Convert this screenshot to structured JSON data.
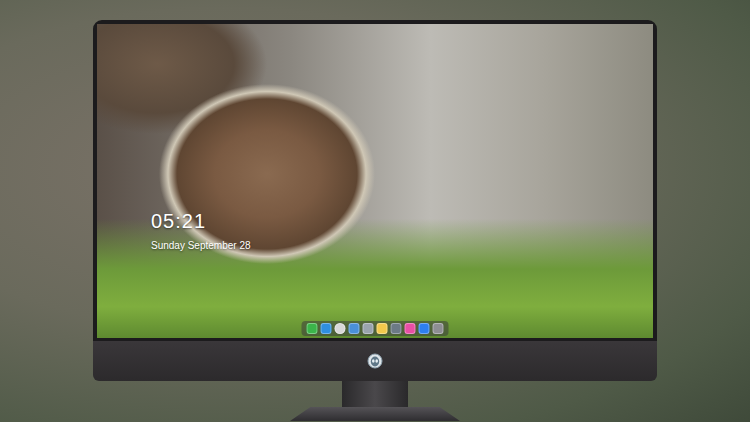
{
  "screen": {
    "time": "05:21",
    "date": "Sunday September 28"
  },
  "dock": {
    "items": [
      {
        "color": "#3bb54a"
      },
      {
        "color": "#2f8fe0"
      },
      {
        "color": "#d8d8d8"
      },
      {
        "color": "#4a90d9"
      },
      {
        "color": "#9aa4ad"
      },
      {
        "color": "#f2c94c"
      },
      {
        "color": "#6c7a86"
      },
      {
        "color": "#e84fa5"
      },
      {
        "color": "#2d7ff0"
      },
      {
        "color": "#8e8e93"
      }
    ]
  }
}
